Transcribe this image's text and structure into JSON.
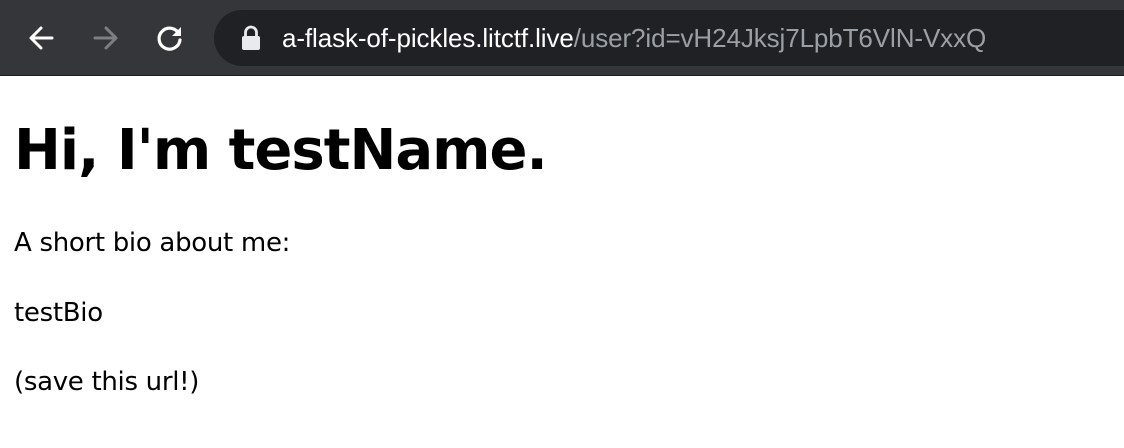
{
  "browser": {
    "url_host": "a-flask-of-pickles.litctf.live",
    "url_path": "/user?id=vH24Jksj7LpbT6VlN-VxxQ",
    "icons": {
      "back": "arrow-left-icon",
      "forward": "arrow-right-icon",
      "reload": "reload-icon",
      "lock": "lock-icon"
    },
    "colors": {
      "toolbar": "#35363a",
      "omnibox": "#202124",
      "host_text": "#ffffff",
      "path_text": "#9aa0a6"
    }
  },
  "page": {
    "heading": "Hi, I'm testName.",
    "bio_label": "A short bio about me:",
    "bio_text": "testBio",
    "save_note": "(save this url!)"
  }
}
